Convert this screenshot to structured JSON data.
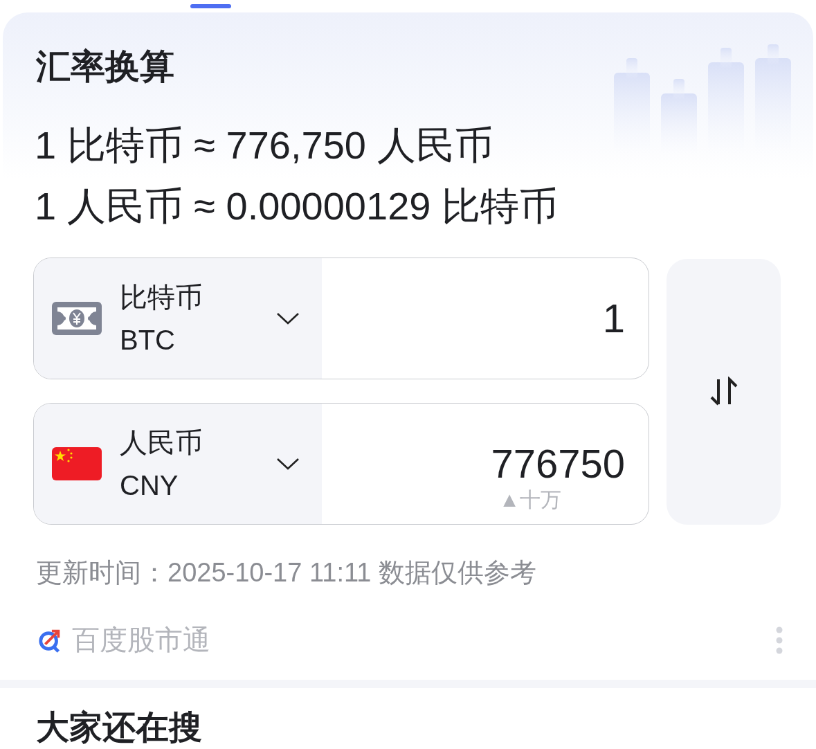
{
  "title": "汇率换算",
  "rates": [
    "1 比特币 ≈ 776,750 人民币",
    "1 人民币 ≈ 0.00000129 比特币"
  ],
  "converters": [
    {
      "kind": "banknote",
      "name": "比特币",
      "code": "BTC",
      "amount": "1"
    },
    {
      "kind": "flag",
      "name": "人民币",
      "code": "CNY",
      "amount": "776750",
      "hint": "▲十万"
    }
  ],
  "update_text": "更新时间：2025-10-17 11:11 数据仅供参考",
  "source": "百度股市通",
  "next_section": {
    "title": "大家还在搜"
  }
}
